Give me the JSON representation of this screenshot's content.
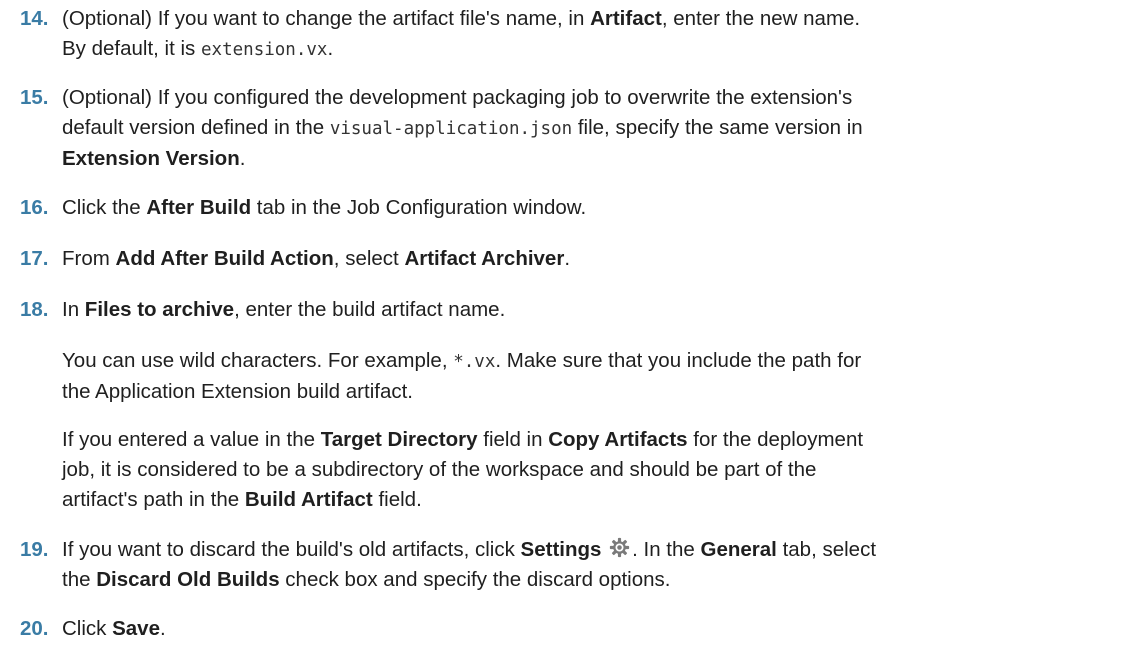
{
  "steps": [
    {
      "num": "14.",
      "t1": "(Optional) If you want to change the artifact file's name, in ",
      "b1": "Artifact",
      "t2": ", enter the new name.",
      "t3": "By default, it is ",
      "c1": "extension.vx",
      "t4": "."
    },
    {
      "num": "15.",
      "t1": "(Optional) If you configured the development packaging job to overwrite the extension's",
      "t2": "default version defined in the ",
      "c1": "visual-application.json",
      "t3": " file, specify the same version in",
      "b1": "Extension Version",
      "t4": "."
    },
    {
      "num": "16.",
      "t1": "Click the ",
      "b1": "After Build",
      "t2": " tab in the Job Configuration window."
    },
    {
      "num": "17.",
      "t1": "From ",
      "b1": "Add After Build Action",
      "t2": ", select ",
      "b2": "Artifact Archiver",
      "t3": "."
    },
    {
      "num": "18.",
      "t1": "In ",
      "b1": "Files to archive",
      "t2": ", enter the build artifact name.",
      "p1_t1": "You can use wild characters. For example, ",
      "p1_c1": "*.vx",
      "p1_t2": ". Make sure that you include the path for",
      "p1_t3": "the Application Extension build artifact.",
      "p2_t1": "If you entered a value in the ",
      "p2_b1": "Target Directory",
      "p2_t2": " field in ",
      "p2_b2": "Copy Artifacts",
      "p2_t3": " for the deployment",
      "p2_t4": "job, it is considered to be a subdirectory of the workspace and should be part of the",
      "p2_t5": "artifact's path in the ",
      "p2_b3": "Build Artifact",
      "p2_t6": " field."
    },
    {
      "num": "19.",
      "t1": "If you want to discard the build's old artifacts, click ",
      "b1": "Settings",
      "icon": "gear-icon",
      "t2": ". In the ",
      "b2": "General",
      "t3": " tab, select",
      "t4": "the ",
      "b3": "Discard Old Builds",
      "t5": " check box and specify the discard options."
    },
    {
      "num": "20.",
      "t1": "Click ",
      "b1": "Save",
      "t2": "."
    }
  ],
  "colors": {
    "step_number": "#3a7ca5",
    "text": "#1f1f1f",
    "gear_icon": "#7a7a7a"
  }
}
